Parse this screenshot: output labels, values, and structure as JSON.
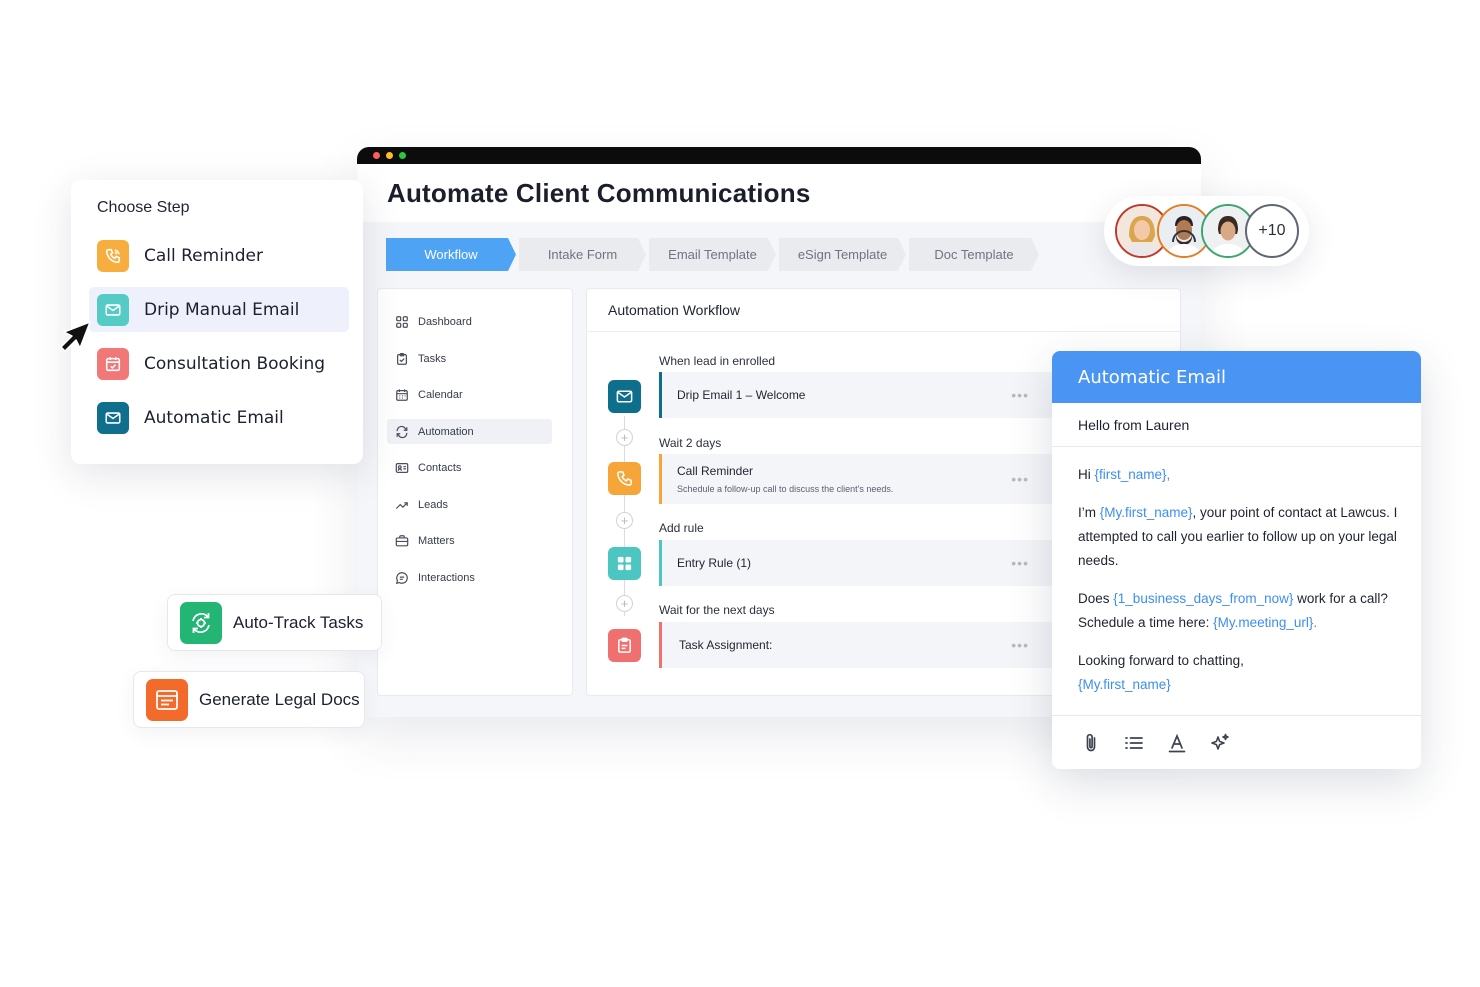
{
  "window": {
    "title": "Automate Client Communications",
    "dots": [
      "#ff5f57",
      "#febc2e",
      "#28c840"
    ]
  },
  "tabs": [
    {
      "label": "Workflow",
      "active": true
    },
    {
      "label": "Intake Form"
    },
    {
      "label": "Email Template"
    },
    {
      "label": "eSign Template"
    },
    {
      "label": "Doc Template"
    }
  ],
  "sidebar": {
    "items": [
      {
        "label": "Dashboard",
        "icon": "grid-icon"
      },
      {
        "label": "Tasks",
        "icon": "clipboard-icon"
      },
      {
        "label": "Calendar",
        "icon": "calendar-icon"
      },
      {
        "label": "Automation",
        "icon": "repeat-icon",
        "active": true
      },
      {
        "label": "Contacts",
        "icon": "id-card-icon"
      },
      {
        "label": "Leads",
        "icon": "trend-icon"
      },
      {
        "label": "Matters",
        "icon": "briefcase-icon"
      },
      {
        "label": "Interactions",
        "icon": "chat-icon"
      }
    ]
  },
  "workflow": {
    "title": "Automation Workflow",
    "steps": [
      {
        "label": "When lead in enrolled",
        "title": "Drip Email 1 – Welcome",
        "desc": "",
        "color": "#0e6f8d",
        "icon": "mail-icon"
      },
      {
        "label": "Wait 2 days",
        "title": "Call Reminder",
        "desc": "Schedule a follow-up call to discuss the client's needs.",
        "color": "#f6a538",
        "icon": "phone-icon"
      },
      {
        "label": "Add rule",
        "title": "Entry Rule (1)",
        "desc": "",
        "color": "#4cc6c1",
        "icon": "grid-icon"
      },
      {
        "label": "Wait for the next days",
        "title": "Task Assignment:",
        "desc": "",
        "color": "#f07070",
        "icon": "clipboard-icon"
      }
    ]
  },
  "choose_step": {
    "title": "Choose Step",
    "items": [
      {
        "label": "Call Reminder",
        "color": "#f8ae3f",
        "icon": "phone-icon"
      },
      {
        "label": "Drip Manual Email",
        "color": "#54cbc4",
        "icon": "mail-icon",
        "active": true
      },
      {
        "label": "Consultation Booking",
        "color": "#f27777",
        "icon": "calendar-icon"
      },
      {
        "label": "Automatic Email",
        "color": "#0f6f8c",
        "icon": "mail-icon"
      }
    ]
  },
  "pills": {
    "auto_track": {
      "label": "Auto-Track Tasks",
      "color": "#22b573"
    },
    "legal_docs": {
      "label": "Generate Legal Docs",
      "color": "#f26b2a"
    }
  },
  "avatars": {
    "more": "+10",
    "rings": [
      "#c0392b",
      "#e67e22",
      "#3aa66a"
    ]
  },
  "email": {
    "header": "Automatic Email",
    "subject": "Hello from Lauren",
    "greeting_prefix": "Hi ",
    "greeting_var": "{first_name},",
    "p1_pre": "I’m ",
    "p1_var": "{My.first_name}",
    "p1_post": ", your point of contact at Lawcus. I attempted to call you earlier to follow up on your legal needs.",
    "p2_pre": "Does ",
    "p2_var": "{1_business_days_from_now}",
    "p2_mid": " work for a call? Schedule a time here: ",
    "p2_var2": "{My.meeting_url}.",
    "p3": "Looking forward to chatting,",
    "p3_var": "{My.first_name}",
    "tools": [
      "paperclip-icon",
      "list-icon",
      "text-format-icon",
      "sparkle-icon"
    ]
  }
}
